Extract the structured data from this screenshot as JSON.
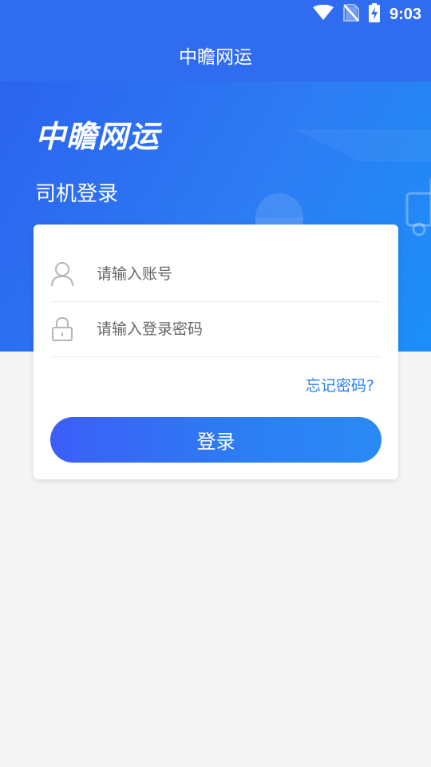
{
  "status_bar": {
    "time": "9:03",
    "icons": [
      "wifi-icon",
      "no-sim-icon",
      "battery-charging-icon"
    ]
  },
  "app_bar": {
    "title": "中瞻网运"
  },
  "banner": {
    "logo_text": "中瞻网运",
    "subtitle": "司机登录"
  },
  "login_form": {
    "account_placeholder": "请输入账号",
    "account_value": "",
    "password_placeholder": "请输入登录密码",
    "password_value": "",
    "forgot_label": "忘记密码?",
    "submit_label": "登录"
  },
  "colors": {
    "primary": "#2f6cf0",
    "link": "#2a7ff3",
    "background": "#f5f5f5"
  }
}
